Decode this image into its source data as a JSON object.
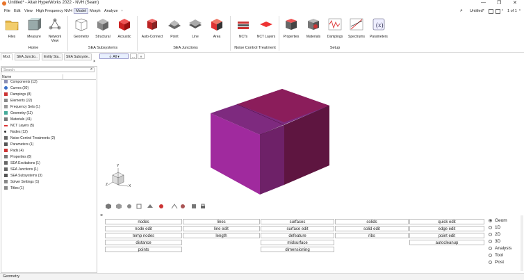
{
  "window": {
    "title": "Untitled* - Altair HyperWorks 2022 - NVH (Seam)",
    "minimize": "—",
    "restore": "❐",
    "close": "✕"
  },
  "menu": [
    "File",
    "Edit",
    "View",
    "High Frequency NVH",
    "Model",
    "Morph",
    "Analyze"
  ],
  "menu_add": "+",
  "topright": {
    "session": "Untitled*",
    "pages": "1 of 1"
  },
  "ribbon": {
    "tools": [
      {
        "label": "Files",
        "icon": "folder-icon"
      },
      {
        "label": "Measure",
        "icon": "measure-icon"
      },
      {
        "label": "Network\nView",
        "icon": "network-icon"
      },
      {
        "label": "Geometry",
        "icon": "geometry-icon"
      },
      {
        "label": "Structural",
        "icon": "structural-icon"
      },
      {
        "label": "Acoustic",
        "icon": "acoustic-icon"
      },
      {
        "label": "Auto-Connect",
        "icon": "auto-connect-icon"
      },
      {
        "label": "Point",
        "icon": "point-icon"
      },
      {
        "label": "Line",
        "icon": "line-icon"
      },
      {
        "label": "Area",
        "icon": "area-icon"
      },
      {
        "label": "NCTs",
        "icon": "ncts-icon"
      },
      {
        "label": "NCT Layers",
        "icon": "nct-layers-icon"
      },
      {
        "label": "Properties",
        "icon": "properties-icon"
      },
      {
        "label": "Materials",
        "icon": "materials-icon"
      },
      {
        "label": "Dampings",
        "icon": "dampings-icon"
      },
      {
        "label": "Spectrums",
        "icon": "spectrums-icon"
      },
      {
        "label": "Parameters",
        "icon": "parameters-icon"
      }
    ],
    "groups": [
      "Home",
      "SEA Subsystems",
      "SEA Junctions",
      "Noise Control Treatment",
      "Setup"
    ]
  },
  "tabs": [
    "Mod.",
    "SEA Junctio..",
    "Entity Sta..",
    "SEA Subsyste.."
  ],
  "filter": {
    "label": "All",
    "more": "...",
    "next": "»"
  },
  "search": {
    "placeholder": "Search"
  },
  "tree_header": "Name",
  "tree": [
    {
      "label": "Components  (12)",
      "color": "#8b8fb5"
    },
    {
      "label": "Curves  (30)",
      "color": "#3a6fc9"
    },
    {
      "label": "Dampings  (8)",
      "color": "#c33"
    },
    {
      "label": "Elements  (22)",
      "color": "#888"
    },
    {
      "label": "Frequency Sets  (1)",
      "color": "#999"
    },
    {
      "label": "Geometry  (11)",
      "color": "#4a9"
    },
    {
      "label": "Materials  (41)",
      "color": "#777"
    },
    {
      "label": "NCT Layers  (5)",
      "color": "#d33"
    },
    {
      "label": "Nodes  (12)",
      "color": "#333"
    },
    {
      "label": "Noise Control Treatments  (2)",
      "color": "#666"
    },
    {
      "label": "Parameters  (1)",
      "color": "#555"
    },
    {
      "label": "Pads  (4)",
      "color": "#c33"
    },
    {
      "label": "Properties  (8)",
      "color": "#777"
    },
    {
      "label": "SEA Excitations  (1)",
      "color": "#666"
    },
    {
      "label": "SEA Junctions  (1)",
      "color": "#666"
    },
    {
      "label": "SEA Subsystems  (3)",
      "color": "#555"
    },
    {
      "label": "Solver Settings  (1)",
      "color": "#888"
    },
    {
      "label": "Titles  (1)",
      "color": "#888"
    }
  ],
  "triad": {
    "x": "X",
    "y": "Y",
    "z": "Z"
  },
  "commands": [
    [
      "nodes",
      "lines",
      "surfaces",
      "solids",
      "quick edit"
    ],
    [
      "node edit",
      "line edit",
      "surface edit",
      "solid edit",
      "edge edit"
    ],
    [
      "temp nodes",
      "length",
      "defeature",
      "ribs",
      "point edit"
    ],
    [
      "distance",
      "",
      "midsurface",
      "",
      "autocleanup"
    ],
    [
      "points",
      "",
      "dimensioning",
      "",
      ""
    ]
  ],
  "panel_close": "×",
  "radios": [
    {
      "label": "Geom",
      "selected": true
    },
    {
      "label": "1D",
      "selected": false
    },
    {
      "label": "2D",
      "selected": false
    },
    {
      "label": "3D",
      "selected": false
    },
    {
      "label": "Analysis",
      "selected": false
    },
    {
      "label": "Tool",
      "selected": false
    },
    {
      "label": "Post",
      "selected": false
    }
  ],
  "status": "Geometry",
  "colors": {
    "box_front": "#a02a9e",
    "box_top_left": "#7e2a7f",
    "box_top_right": "#8b1d5b",
    "box_side": "#5e1540",
    "accent": "#e8742a"
  }
}
